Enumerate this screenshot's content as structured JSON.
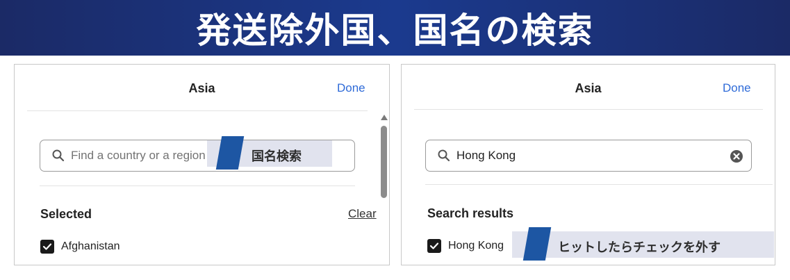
{
  "banner": {
    "title": "発送除外国、国名の検索"
  },
  "left_panel": {
    "title": "Asia",
    "done_label": "Done",
    "search": {
      "placeholder": "Find a country or a region",
      "icon": "search-icon"
    },
    "section_title": "Selected",
    "clear_label": "Clear",
    "items": [
      {
        "label": "Afghanistan",
        "checked": true
      }
    ]
  },
  "right_panel": {
    "title": "Asia",
    "done_label": "Done",
    "search": {
      "value": "Hong Kong",
      "icon": "search-icon",
      "clear_icon": "clear-circle-icon"
    },
    "section_title": "Search results",
    "items": [
      {
        "label": "Hong Kong",
        "checked": true
      }
    ]
  },
  "callouts": {
    "search_hint": "国名検索",
    "uncheck_hint": "ヒットしたらチェックを外す"
  },
  "colors": {
    "banner_bg": "#1b2a66",
    "link_blue": "#2f6bd8",
    "callout_accent": "#1d56a3",
    "callout_bg": "#e1e3ee"
  }
}
